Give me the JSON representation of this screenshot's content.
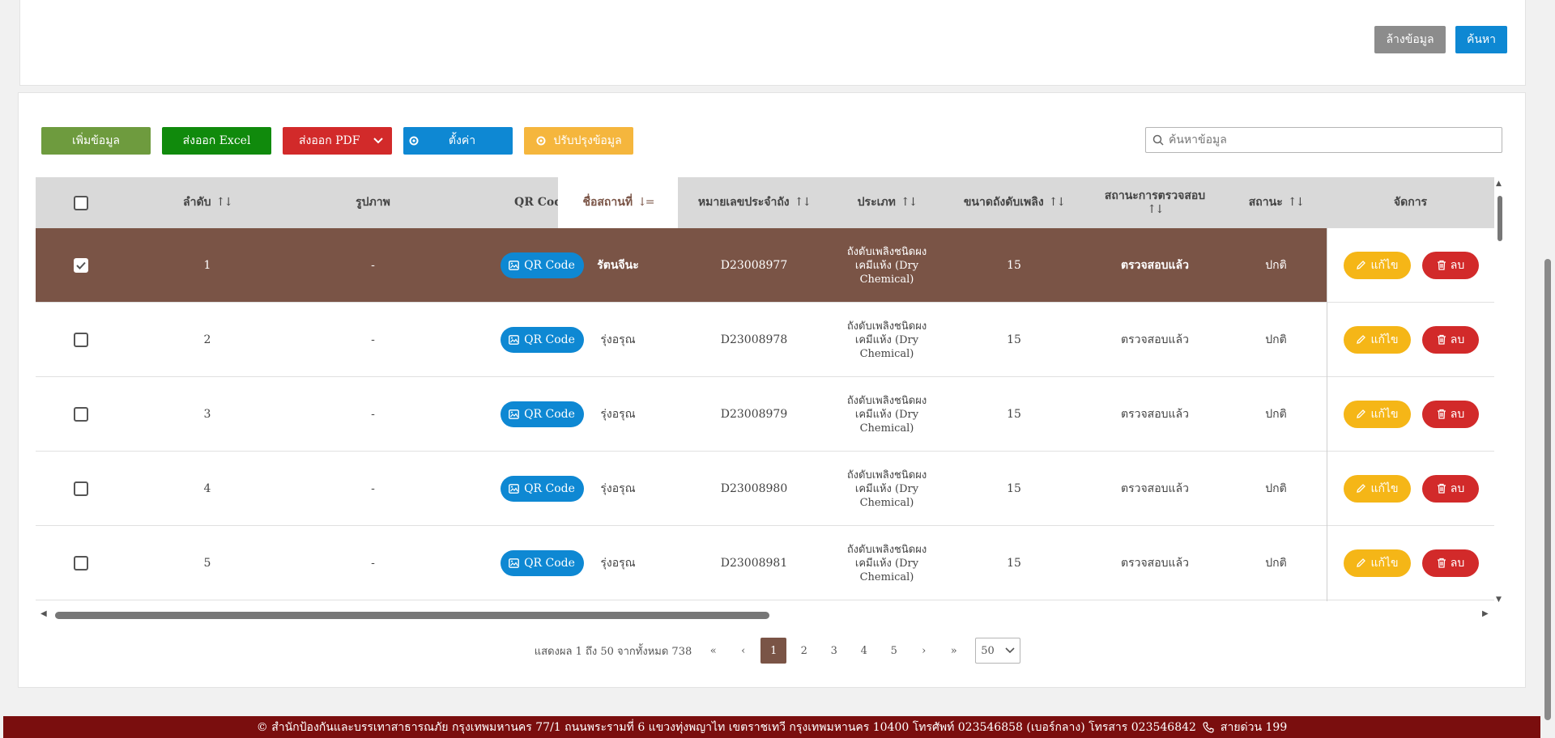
{
  "filter": {
    "clear_label": "ล้างข้อมูล",
    "search_label": "ค้นหา"
  },
  "toolbar": {
    "add_label": "เพิ่มข้อมูล",
    "excel_label": "ส่งออก Excel",
    "pdf_label": "ส่งออก PDF",
    "settings_label": "ตั้งค่า",
    "update_label": "ปรับปรุงข้อมูล",
    "search_placeholder": "ค้นหาข้อมูล"
  },
  "table": {
    "headers": {
      "order": "ลำดับ",
      "image": "รูปภาพ",
      "qr": "QR Code",
      "location": "ชื่อสถานที่",
      "serial": "หมายเลขประจำถัง",
      "type": "ประเภท",
      "size": "ขนาดถังดับเพลิง",
      "inspection": "สถานะการตรวจสอบ",
      "status": "สถานะ",
      "manage": "จัดการ"
    },
    "rows": [
      {
        "no": "1",
        "image": "-",
        "qr": "QR Code",
        "location": "รัตนจีนะ",
        "serial": "D23008977",
        "type": "ถังดับเพลิงชนิดผงเคมีแห้ง (Dry Chemical)",
        "size": "15",
        "inspection": "ตรวจสอบแล้ว",
        "status": "ปกติ",
        "edit": "แก้ไข",
        "delete": "ลบ",
        "selected": true
      },
      {
        "no": "2",
        "image": "-",
        "qr": "QR Code",
        "location": "รุ่งอรุณ",
        "serial": "D23008978",
        "type": "ถังดับเพลิงชนิดผงเคมีแห้ง (Dry Chemical)",
        "size": "15",
        "inspection": "ตรวจสอบแล้ว",
        "status": "ปกติ",
        "edit": "แก้ไข",
        "delete": "ลบ",
        "selected": false
      },
      {
        "no": "3",
        "image": "-",
        "qr": "QR Code",
        "location": "รุ่งอรุณ",
        "serial": "D23008979",
        "type": "ถังดับเพลิงชนิดผงเคมีแห้ง (Dry Chemical)",
        "size": "15",
        "inspection": "ตรวจสอบแล้ว",
        "status": "ปกติ",
        "edit": "แก้ไข",
        "delete": "ลบ",
        "selected": false
      },
      {
        "no": "4",
        "image": "-",
        "qr": "QR Code",
        "location": "รุ่งอรุณ",
        "serial": "D23008980",
        "type": "ถังดับเพลิงชนิดผงเคมีแห้ง (Dry Chemical)",
        "size": "15",
        "inspection": "ตรวจสอบแล้ว",
        "status": "ปกติ",
        "edit": "แก้ไข",
        "delete": "ลบ",
        "selected": false
      },
      {
        "no": "5",
        "image": "-",
        "qr": "QR Code",
        "location": "รุ่งอรุณ",
        "serial": "D23008981",
        "type": "ถังดับเพลิงชนิดผงเคมีแห้ง (Dry Chemical)",
        "size": "15",
        "inspection": "ตรวจสอบแล้ว",
        "status": "ปกติ",
        "edit": "แก้ไข",
        "delete": "ลบ",
        "selected": false
      }
    ]
  },
  "pagination": {
    "summary": "แสดงผล 1 ถึง 50 จากทั้งหมด 738",
    "first": "«",
    "prev": "‹",
    "pages": [
      "1",
      "2",
      "3",
      "4",
      "5"
    ],
    "current": "1",
    "next": "›",
    "last": "»",
    "page_size": "50"
  },
  "footer": {
    "text": "© สำนักป้องกันและบรรเทาสาธารณภัย กรุงเทพมหานคร 77/1 ถนนพระรามที่ 6 แขวงทุ่งพญาไท เขตราชเทวี กรุงเทพมหานคร 10400 โทรศัพท์ 023546858 (เบอร์กลาง) โทรสาร 023546842",
    "hotline": "สายด่วน 199"
  },
  "colors": {
    "selected_row": "#7a5446",
    "primary": "#0e88d3",
    "danger": "#d22a2a",
    "warning": "#f5b617",
    "add": "#6e9b3e",
    "excel": "#108a0c",
    "footer": "#7a0e0e"
  },
  "icons": {
    "qr": "image-icon",
    "edit": "pencil-icon",
    "delete": "trash-icon",
    "settings": "gear-icon",
    "search": "search-icon",
    "hotline": "phone-icon"
  }
}
